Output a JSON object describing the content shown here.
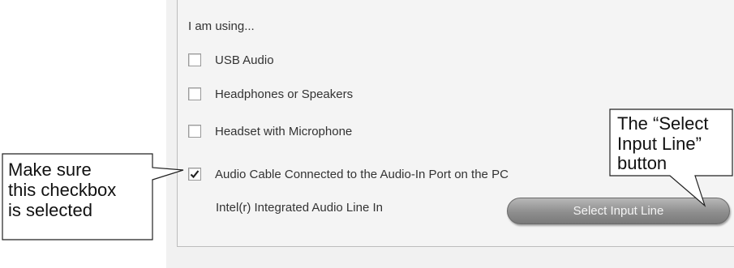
{
  "panel": {
    "heading": "I am using...",
    "options": [
      {
        "label": "USB Audio",
        "checked": false
      },
      {
        "label": "Headphones or Speakers",
        "checked": false
      },
      {
        "label": "Headset with Microphone",
        "checked": false
      },
      {
        "label": "Audio Cable Connected to the Audio-In Port on the PC",
        "checked": true
      }
    ],
    "device_name": "Intel(r) Integrated Audio Line In",
    "select_button": "Select Input Line"
  },
  "callouts": {
    "left": [
      "Make sure",
      "this checkbox",
      "is selected"
    ],
    "right": [
      "The “Select",
      "Input Line”",
      "button"
    ]
  }
}
